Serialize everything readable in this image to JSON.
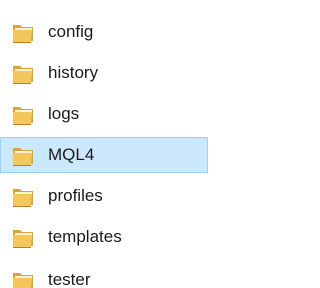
{
  "folders": [
    {
      "label": "config",
      "selected": false
    },
    {
      "label": "history",
      "selected": false
    },
    {
      "label": "logs",
      "selected": false
    },
    {
      "label": "MQL4",
      "selected": true
    },
    {
      "label": "profiles",
      "selected": false
    },
    {
      "label": "templates",
      "selected": false
    },
    {
      "label": "tester",
      "selected": false
    }
  ],
  "icon": "folder-icon",
  "colors": {
    "selection_fill": "#cce8ff",
    "selection_border": "#99d1ff",
    "folder_front": "#f3c75b",
    "folder_back": "#d9a43a",
    "folder_shadow": "#b68424",
    "text": "#1a1a1a"
  }
}
